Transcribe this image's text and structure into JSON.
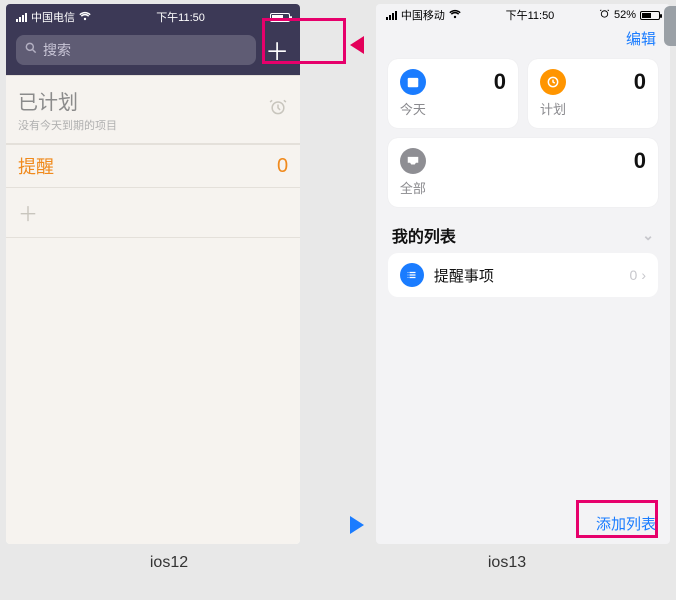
{
  "ios12": {
    "status": {
      "carrier": "中国电信",
      "time": "下午11:50"
    },
    "search_placeholder": "搜索",
    "scheduled": {
      "title": "已计划",
      "subtitle": "没有今天到期的项目"
    },
    "reminders": {
      "title": "提醒",
      "count": "0"
    },
    "add_glyph": "＋"
  },
  "ios13": {
    "status": {
      "carrier": "中国移动",
      "time": "下午11:50",
      "battery_pct": "52%"
    },
    "edit": "编辑",
    "cards": {
      "today": {
        "label": "今天",
        "count": "0"
      },
      "planned": {
        "label": "计划",
        "count": "0"
      },
      "all": {
        "label": "全部",
        "count": "0"
      }
    },
    "mylist_header": "我的列表",
    "list_item": {
      "title": "提醒事项",
      "count": "0"
    },
    "add_list": "添加列表"
  },
  "captions": {
    "left": "ios12",
    "right": "ios13"
  }
}
